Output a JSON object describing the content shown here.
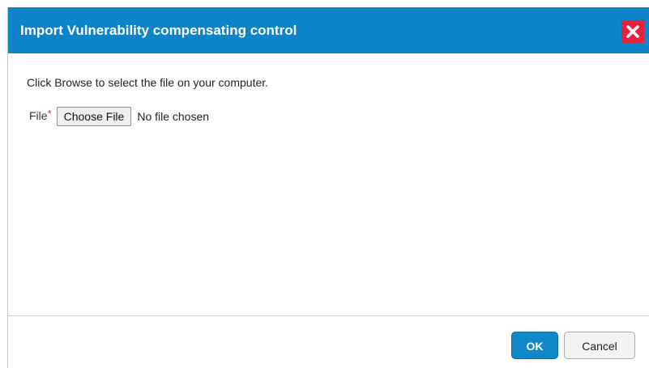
{
  "dialog": {
    "title": "Import Vulnerability compensating control",
    "close_icon": "close-icon",
    "instructions": "Click Browse to select the file on your computer.",
    "file_field": {
      "label": "File",
      "required_marker": "*",
      "button_label": "Choose File",
      "status": "No file chosen"
    },
    "footer": {
      "ok_label": "OK",
      "cancel_label": "Cancel"
    }
  },
  "colors": {
    "titlebar": "#0c84c7",
    "close_button": "#e8213b",
    "ok_button": "#1188c9",
    "required_marker": "#e8213b"
  }
}
